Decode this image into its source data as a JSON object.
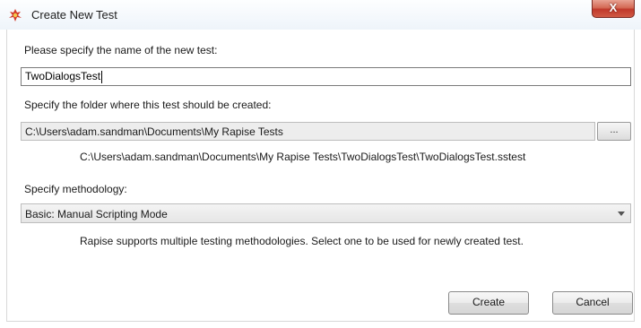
{
  "window": {
    "title": "Create New Test",
    "close_label": "X"
  },
  "test_name": {
    "label": "Please specify the name of the new test:",
    "value": "TwoDialogsTest"
  },
  "folder": {
    "label": "Specify the folder where this test should be created:",
    "value": "C:\\Users\\adam.sandman\\Documents\\My Rapise Tests",
    "browse_label": "...",
    "full_path": "C:\\Users\\adam.sandman\\Documents\\My Rapise Tests\\TwoDialogsTest\\TwoDialogsTest.sstest"
  },
  "methodology": {
    "label": "Specify methodology:",
    "selected": "Basic: Manual Scripting Mode",
    "hint": "Rapise supports multiple testing methodologies. Select one to be used for newly created test."
  },
  "buttons": {
    "create": "Create",
    "cancel": "Cancel"
  },
  "icons": {
    "app": "rapise-bug-icon",
    "close": "close-icon",
    "dropdown": "chevron-down-icon"
  },
  "colors": {
    "close_button": "#c0392b",
    "app_icon": "#d23a2a"
  }
}
